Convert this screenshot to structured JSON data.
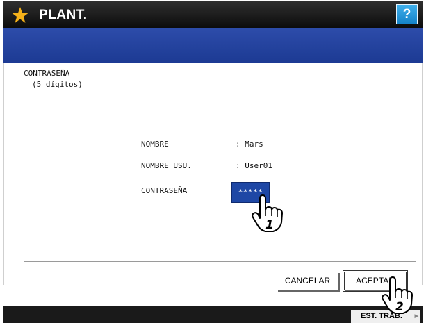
{
  "header": {
    "title": "PLANT.",
    "help_label": "?",
    "icon": "star-icon"
  },
  "heading": {
    "line1": "CONTRASEÑA",
    "line2": "(5 dígitos)"
  },
  "form": {
    "name_label": "NOMBRE",
    "name_value": ": Mars",
    "user_label": "NOMBRE USU.",
    "user_value": ": User01",
    "password_label": "CONTRASEÑA",
    "password_value": "*****"
  },
  "buttons": {
    "cancel": "CANCELAR",
    "accept": "ACEPTAR"
  },
  "footer": {
    "status_tab": "EST. TRAB."
  },
  "callouts": {
    "step1": "1",
    "step2": "2"
  },
  "colors": {
    "accent": "#1e47a5",
    "titlebar": "#111111",
    "help": "#1e90d8"
  }
}
